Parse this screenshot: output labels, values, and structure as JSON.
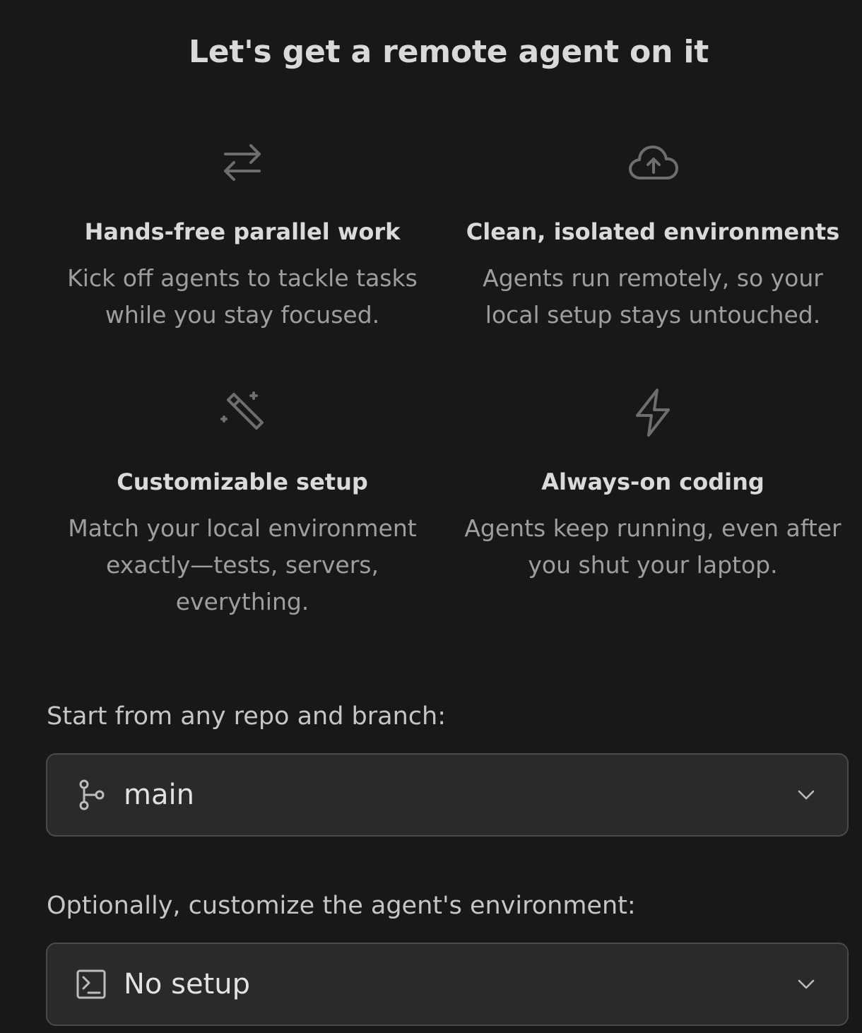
{
  "title": "Let's get a remote agent on it",
  "features": [
    {
      "icon": "arrows-swap-icon",
      "title": "Hands-free parallel work",
      "lines": [
        "Kick off agents to tackle tasks",
        "while you stay focused."
      ]
    },
    {
      "icon": "cloud-upload-icon",
      "title": "Clean, isolated environments",
      "lines": [
        "Agents run remotely, so your",
        "local setup stays untouched."
      ]
    },
    {
      "icon": "magic-wand-icon",
      "title": "Customizable setup",
      "lines": [
        "Match your local environment",
        "exactly—tests, servers,",
        "everything."
      ]
    },
    {
      "icon": "lightning-icon",
      "title": "Always-on coding",
      "lines": [
        "Agents keep running, even after",
        "you shut your laptop."
      ]
    }
  ],
  "repo": {
    "label": "Start from any repo and branch:",
    "value": "main",
    "icon": "git-branch-icon"
  },
  "environment": {
    "label": "Optionally, customize the agent's environment:",
    "value": "No setup",
    "icon": "terminal-icon"
  },
  "colors": {
    "background": "#181818",
    "field_background": "#2a2a2a",
    "field_border": "#4a4a4a",
    "icon": "#6e6e6e"
  }
}
